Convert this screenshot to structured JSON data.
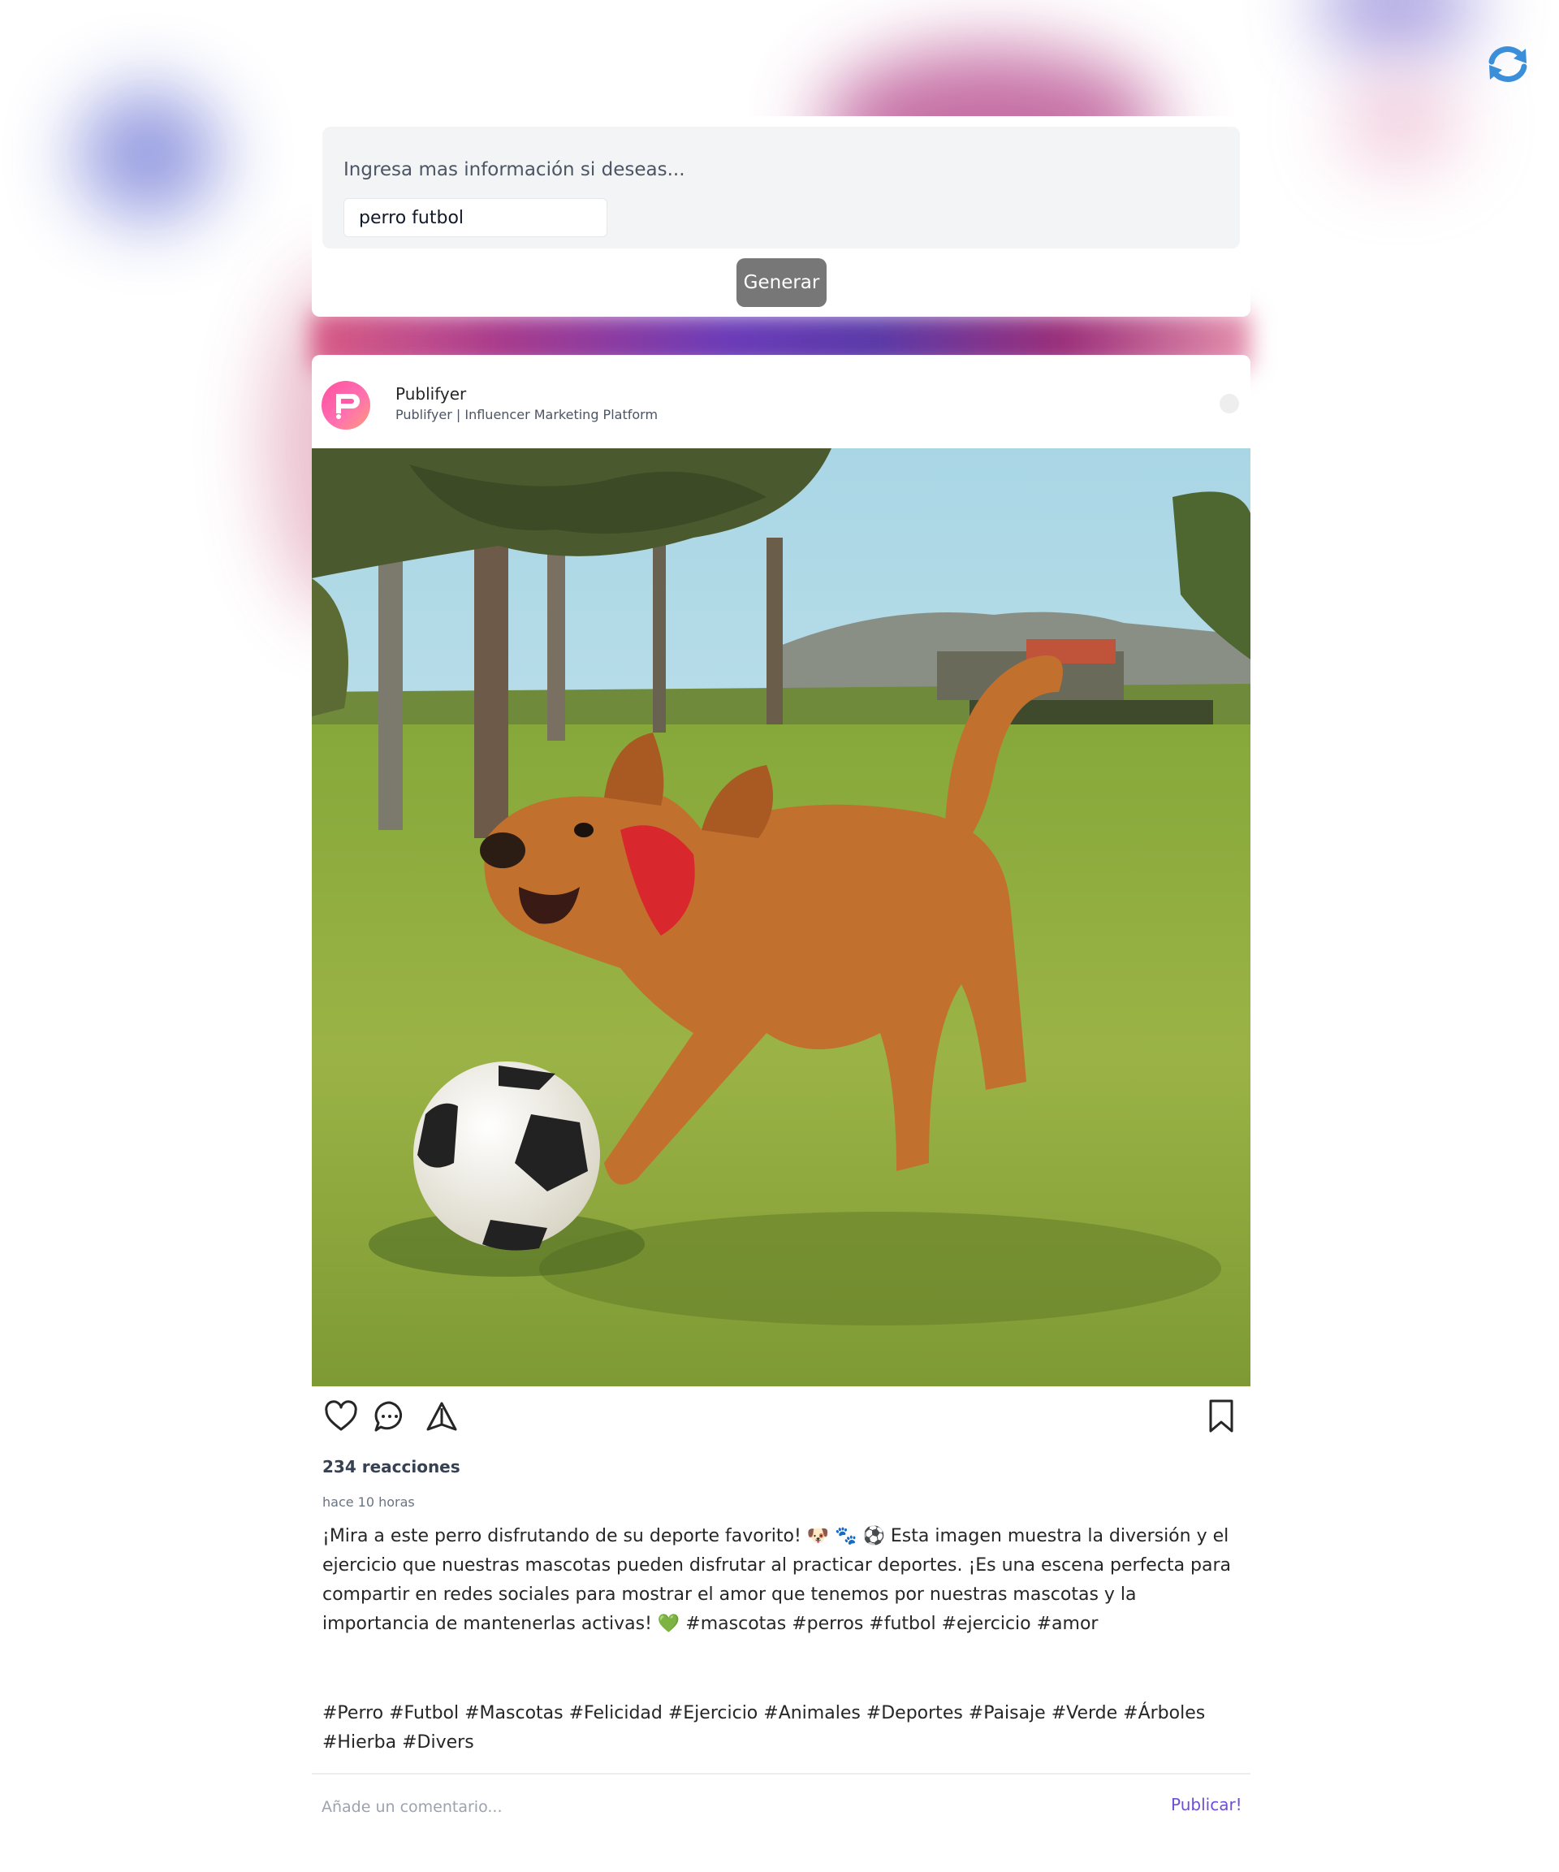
{
  "app": {
    "refresh_icon": "refresh-sync-icon"
  },
  "generator": {
    "label": "Ingresa mas información si deseas...",
    "input_value": "perro futbol",
    "button_label": "Generar"
  },
  "post": {
    "account_name": "Publifyer",
    "account_subtitle": "Publifyer | Influencer Marketing Platform",
    "avatar_icon": "publifyer-logo-icon",
    "image_icon": "post-image",
    "actions": [
      "heart-icon",
      "comment-icon",
      "share-icon",
      "bookmark-icon"
    ],
    "reactions": "234 reacciones",
    "time": "hace 10 horas",
    "caption": "¡Mira a este perro disfrutando de su deporte favorito! 🐶 🐾 ⚽ Esta imagen muestra la diversión y el ejercicio que nuestras mascotas pueden disfrutar al practicar deportes. ¡Es una escena perfecta para compartir en redes sociales para mostrar el amor que tenemos por nuestras mascotas y la importancia de mantenerlas activas! 💚 #mascotas #perros #futbol #ejercicio #amor",
    "hashtags": "#Perro #Futbol #Mascotas #Felicidad #Ejercicio #Animales #Deportes #Paisaje #Verde #Árboles #Hierba #Divers",
    "comment_placeholder": "Añade un comentario...",
    "publish_label": "Publicar!"
  },
  "colors": {
    "accent_publish": "#6d4fd6",
    "button_bg": "#777777",
    "refresh_icon": "#3b8fd9",
    "avatar_gradient": [
      "#ff4fa0",
      "#ff9a7a"
    ]
  }
}
